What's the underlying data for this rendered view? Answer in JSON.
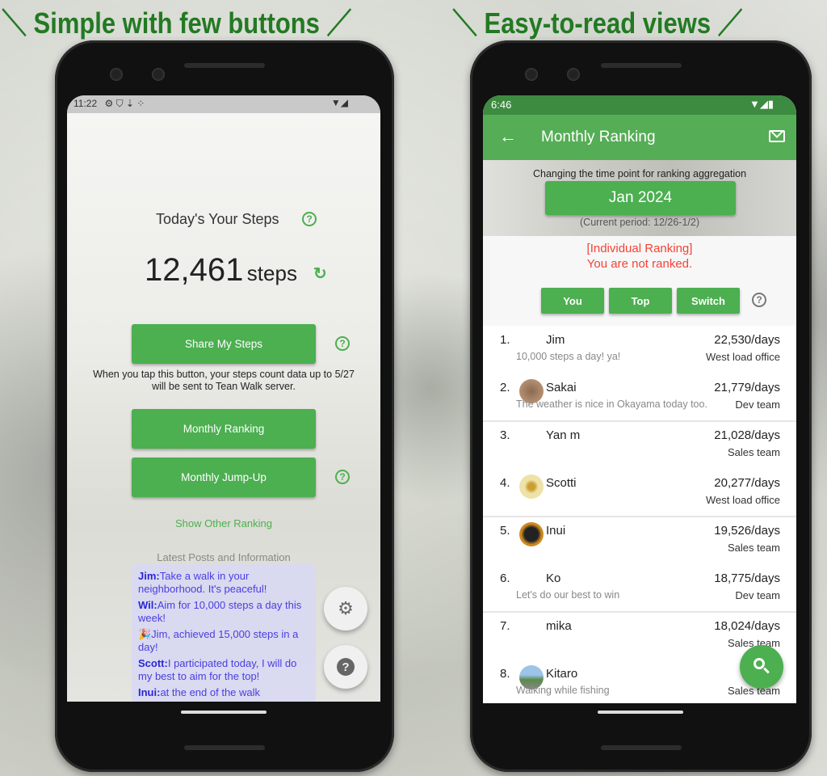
{
  "headline": {
    "left": "＼ Simple with few buttons ／",
    "right": "＼ Easy-to-read views ／"
  },
  "left_phone": {
    "status": {
      "time": "11:22"
    },
    "steps_title": "Today's Your Steps",
    "steps_count": "12,461",
    "steps_unit": "steps",
    "share_button": "Share My Steps",
    "share_note": "When you tap this button, your steps count data up to 5/27 will be sent to Tean Walk server.",
    "monthly_ranking_button": "Monthly Ranking",
    "monthly_jumpup_button": "Monthly Jump-Up",
    "show_other_ranking": "Show Other Ranking",
    "posts_title": "Latest Posts and Information",
    "posts": [
      {
        "author": "Jim:",
        "text": "Take a walk in your neighborhood. It's peaceful!"
      },
      {
        "author": "Wil:",
        "text": "Aim for 10,000 steps a day this week!"
      },
      {
        "author": "",
        "text": "🎉Jim, achieved 15,000 steps in a day!"
      },
      {
        "author": "Scott:",
        "text": "I participated today, I will do my best to aim for the top!"
      },
      {
        "author": "Inui:",
        "text": "at the end of the walk"
      }
    ],
    "help_glyph": "?"
  },
  "right_phone": {
    "status": {
      "time": "6:46"
    },
    "app_bar": {
      "title": "Monthly Ranking",
      "back_icon": "arrow-left-icon",
      "action_icon": "mail-icon"
    },
    "period_label": "Changing the time point for ranking aggregation",
    "period_button": "Jan 2024",
    "current_period": "(Current period: 12/26-1/2)",
    "ranking_type": "[Individual Ranking]",
    "not_ranked": "You are not ranked.",
    "buttons": {
      "you": "You",
      "top": "Top",
      "switch": "Switch"
    },
    "colors": {
      "primary": "#4caf50",
      "status_bar": "#3d8b40",
      "alert": "#f44336"
    },
    "ranking": [
      {
        "rank": "1.",
        "name": "Jim",
        "value": "22,530/days",
        "message": "10,000 steps a day! ya!",
        "team": "West load office",
        "avatar": false
      },
      {
        "rank": "2.",
        "name": "Sakai",
        "value": "21,779/days",
        "message": "The weather is nice in Okayama today too.",
        "team": "Dev team",
        "avatar": true
      },
      {
        "rank": "3.",
        "name": "Yan m",
        "value": "21,028/days",
        "message": "",
        "team": "Sales team",
        "avatar": false
      },
      {
        "rank": "4.",
        "name": "Scotti",
        "value": "20,277/days",
        "message": "",
        "team": "West load office",
        "avatar": true
      },
      {
        "rank": "5.",
        "name": "Inui",
        "value": "19,526/days",
        "message": "",
        "team": "Sales team",
        "avatar": true
      },
      {
        "rank": "6.",
        "name": "Ko",
        "value": "18,775/days",
        "message": "Let's do our best to win",
        "team": "Dev team",
        "avatar": false
      },
      {
        "rank": "7.",
        "name": "mika",
        "value": "18,024/days",
        "message": "",
        "team": "Sales team",
        "avatar": false
      },
      {
        "rank": "8.",
        "name": "Kitaro",
        "value": "17,27",
        "message": "Walking while fishing",
        "team": "Sales team",
        "avatar": true
      }
    ]
  }
}
